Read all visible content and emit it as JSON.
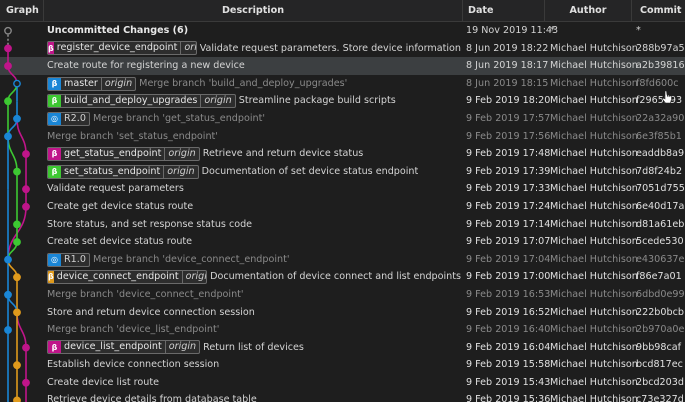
{
  "columns": {
    "graph": "Graph",
    "description": "Description",
    "date": "Date",
    "author": "Author",
    "commit": "Commit"
  },
  "colors": {
    "magenta": "#c0158a",
    "blue": "#1a86d6",
    "green": "#3dc832",
    "orange": "#e09a1c",
    "grey": "#888888"
  },
  "rows": [
    {
      "desc": "Uncommitted Changes (6)",
      "date": "19 Nov 2019 11:43",
      "author": "*",
      "commit": "*",
      "style": "bold"
    },
    {
      "refs": [
        {
          "icon": "branch",
          "color": "#c0158a",
          "name": "register_device_endpoint",
          "origin": "origin"
        }
      ],
      "desc": "Validate request parameters. Store device information",
      "date": "8 Jun 2019 18:22",
      "author": "Michael Hutchison",
      "commit": "288b97a5",
      "style": ""
    },
    {
      "desc": "Create route for registering a new device",
      "date": "8 Jun 2019 18:17",
      "author": "Michael Hutchison",
      "commit": "a2b39816",
      "style": "sel"
    },
    {
      "refs": [
        {
          "icon": "branch",
          "color": "#1a86d6",
          "name": "master",
          "origin": "origin"
        }
      ],
      "desc": "Merge branch 'build_and_deploy_upgrades'",
      "date": "8 Jun 2019 18:15",
      "author": "Michael Hutchison",
      "commit": "f8fd600c",
      "style": "dim"
    },
    {
      "refs": [
        {
          "icon": "branch",
          "color": "#3dc832",
          "name": "build_and_deploy_upgrades",
          "origin": "origin"
        }
      ],
      "desc": "Streamline package build scripts",
      "date": "9 Feb 2019 18:20",
      "author": "Michael Hutchison",
      "commit": "f2965593",
      "style": "strong"
    },
    {
      "refs": [
        {
          "icon": "tag",
          "color": "#1a86d6",
          "name": "R2.0",
          "origin": ""
        }
      ],
      "desc": "Merge branch 'get_status_endpoint'",
      "date": "9 Feb 2019 17:57",
      "author": "Michael Hutchison",
      "commit": "22a32a90",
      "style": "dim"
    },
    {
      "desc": "Merge branch 'set_status_endpoint'",
      "date": "9 Feb 2019 17:56",
      "author": "Michael Hutchison",
      "commit": "6e3f85b1",
      "style": "dim"
    },
    {
      "refs": [
        {
          "icon": "branch",
          "color": "#c0158a",
          "name": "get_status_endpoint",
          "origin": "origin"
        }
      ],
      "desc": "Retrieve and return device status",
      "date": "9 Feb 2019 17:48",
      "author": "Michael Hutchison",
      "commit": "eaddb8a9",
      "style": "strong"
    },
    {
      "refs": [
        {
          "icon": "branch",
          "color": "#3dc832",
          "name": "set_status_endpoint",
          "origin": "origin"
        }
      ],
      "desc": "Documentation of set device status endpoint",
      "date": "9 Feb 2019 17:39",
      "author": "Michael Hutchison",
      "commit": "7d8f24b2",
      "style": "strong"
    },
    {
      "desc": "Validate request parameters",
      "date": "9 Feb 2019 17:33",
      "author": "Michael Hutchison",
      "commit": "7051d755",
      "style": "strong"
    },
    {
      "desc": "Create get device status route",
      "date": "9 Feb 2019 17:24",
      "author": "Michael Hutchison",
      "commit": "6e40d17a",
      "style": "strong"
    },
    {
      "desc": "Store status, and set response status code",
      "date": "9 Feb 2019 17:14",
      "author": "Michael Hutchison",
      "commit": "d81a61eb",
      "style": "strong"
    },
    {
      "desc": "Create set device status route",
      "date": "9 Feb 2019 17:07",
      "author": "Michael Hutchison",
      "commit": "5cede530",
      "style": "strong"
    },
    {
      "refs": [
        {
          "icon": "tag",
          "color": "#1a86d6",
          "name": "R1.0",
          "origin": ""
        }
      ],
      "desc": "Merge branch 'device_connect_endpoint'",
      "date": "9 Feb 2019 17:04",
      "author": "Michael Hutchison",
      "commit": "e430637e",
      "style": "dim"
    },
    {
      "refs": [
        {
          "icon": "branch",
          "color": "#e09a1c",
          "name": "device_connect_endpoint",
          "origin": "origin"
        }
      ],
      "desc": "Documentation of device connect and list endpoints",
      "date": "9 Feb 2019 17:00",
      "author": "Michael Hutchison",
      "commit": "f86e7a01",
      "style": "strong"
    },
    {
      "desc": "Merge branch 'device_connect_endpoint'",
      "date": "9 Feb 2019 16:53",
      "author": "Michael Hutchison",
      "commit": "6dbd0e99",
      "style": "dim"
    },
    {
      "desc": "Store and return device connection session",
      "date": "9 Feb 2019 16:52",
      "author": "Michael Hutchison",
      "commit": "222b0bcb",
      "style": "strong"
    },
    {
      "desc": "Merge branch 'device_list_endpoint'",
      "date": "9 Feb 2019 16:40",
      "author": "Michael Hutchison",
      "commit": "2b970a0e",
      "style": "dim"
    },
    {
      "refs": [
        {
          "icon": "branch",
          "color": "#c0158a",
          "name": "device_list_endpoint",
          "origin": "origin"
        }
      ],
      "desc": "Return list of devices",
      "date": "9 Feb 2019 16:04",
      "author": "Michael Hutchison",
      "commit": "9bb98caf",
      "style": "strong"
    },
    {
      "desc": "Establish device connection session",
      "date": "9 Feb 2019 15:58",
      "author": "Michael Hutchison",
      "commit": "bcd817ec",
      "style": "strong"
    },
    {
      "desc": "Create device list route",
      "date": "9 Feb 2019 15:43",
      "author": "Michael Hutchison",
      "commit": "2bcd203d",
      "style": "strong"
    },
    {
      "desc": "Retrieve device details from database table",
      "date": "9 Feb 2019 15:36",
      "author": "Michael Hutchison",
      "commit": "c73e327d",
      "style": "strong"
    }
  ]
}
